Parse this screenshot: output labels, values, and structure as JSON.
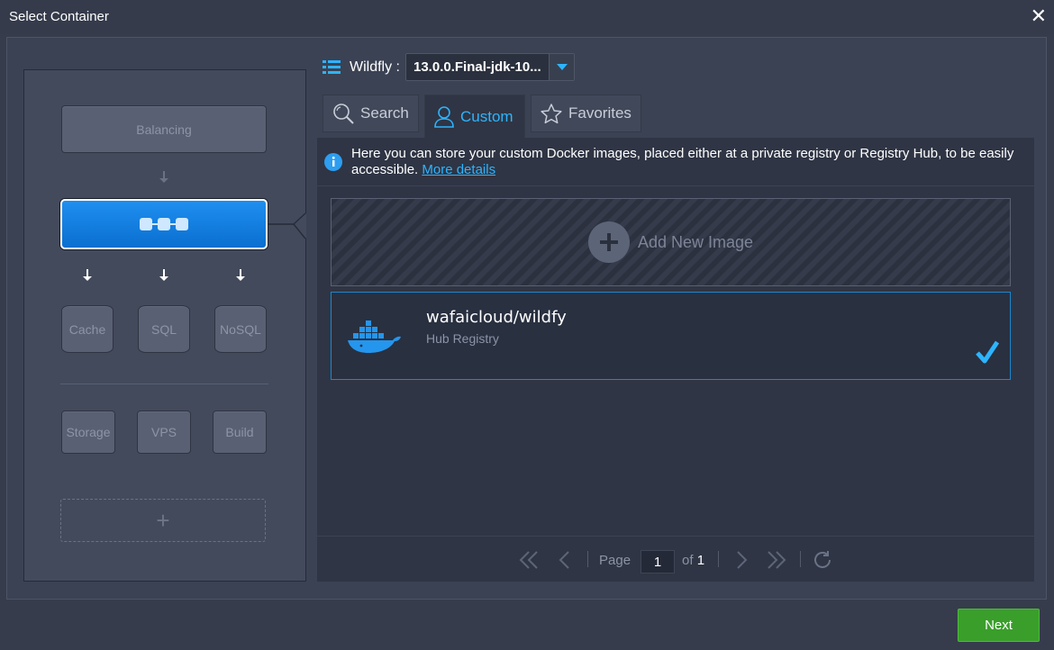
{
  "window": {
    "title": "Select Container",
    "close_icon": "close-icon"
  },
  "topology": {
    "balancing": "Balancing",
    "app_server_icon": "app-server-nodes-icon",
    "databases": [
      "Cache",
      "SQL",
      "NoSQL"
    ],
    "others": [
      "Storage",
      "VPS",
      "Build"
    ],
    "add_icon": "plus-icon"
  },
  "header": {
    "stack_icon": "stack-icon",
    "label": "Wildfly :",
    "version": "13.0.0.Final-jdk-10..."
  },
  "tabs": [
    {
      "label": "Search",
      "icon": "search-icon"
    },
    {
      "label": "Custom",
      "icon": "user-icon",
      "active": true
    },
    {
      "label": "Favorites",
      "icon": "star-icon"
    }
  ],
  "info": {
    "text": "Here you can store your custom Docker images, placed either at a private registry or Registry Hub, to be easily accessible.",
    "link": "More details"
  },
  "add_image": {
    "label": "Add New Image"
  },
  "images": [
    {
      "name": "wafaicloud/wildfy",
      "registry": "Hub Registry",
      "selected": true
    }
  ],
  "pager": {
    "page_label": "Page",
    "page_value": "1",
    "of_label": "of",
    "total": "1"
  },
  "footer": {
    "next_label": "Next"
  },
  "colors": {
    "accent": "#2db4ff",
    "selected_border": "#1c87cc",
    "next_green": "#3a9e2b"
  }
}
